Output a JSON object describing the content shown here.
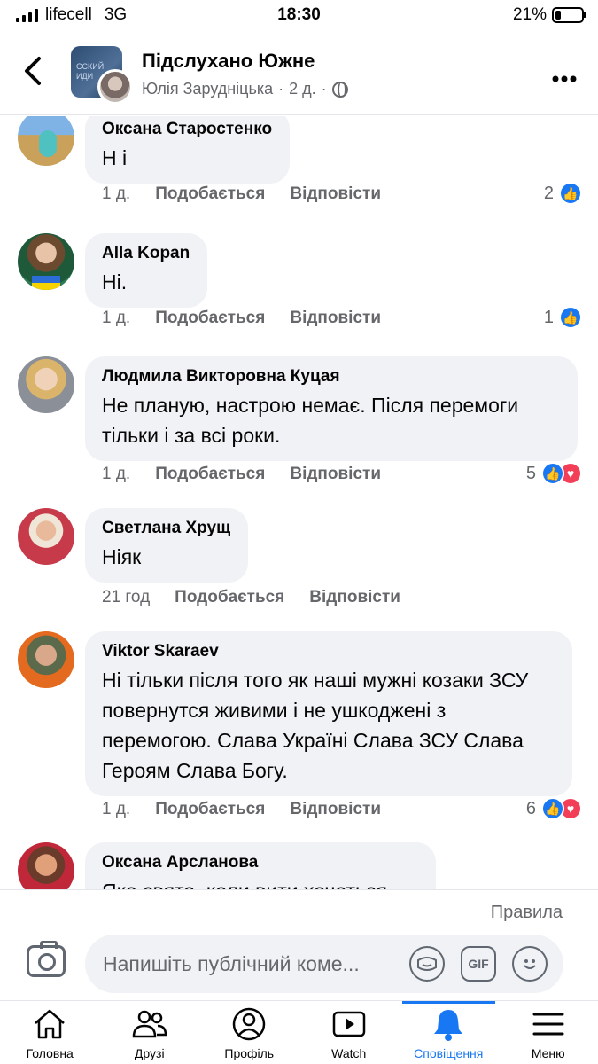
{
  "status_bar": {
    "carrier": "lifecell",
    "network": "3G",
    "time": "18:30",
    "battery": "21%",
    "battery_level": 0.21
  },
  "header": {
    "group_name": "Підслухано Южне",
    "author": "Юлія Зарудніцька",
    "time": "2 д.",
    "separator": "·",
    "group_avatar_text": "ССКИЙ ИДИ",
    "back_icon": "chevron-left-icon",
    "more_icon": "more-horizontal-icon"
  },
  "comments": [
    {
      "author": "Оксана Старостенко",
      "text": "Н і",
      "time": "1 д.",
      "like": "Подобається",
      "reply": "Відповісти",
      "reactions": "2",
      "reaction_types": [
        "like"
      ]
    },
    {
      "author": "Alla Kopan",
      "text": "Ні.",
      "time": "1 д.",
      "like": "Подобається",
      "reply": "Відповісти",
      "reactions": "1",
      "reaction_types": [
        "like"
      ]
    },
    {
      "author": "Людмила Викторовна Куцая",
      "text": "Не планую, настрою немає. Після перемоги тільки і за всі роки.",
      "time": "1 д.",
      "like": "Подобається",
      "reply": "Відповісти",
      "reactions": "5",
      "reaction_types": [
        "like",
        "love"
      ]
    },
    {
      "author": "Светлана Хрущ",
      "text": "Ніяк",
      "time": "21 год",
      "like": "Подобається",
      "reply": "Відповісти",
      "reactions": "",
      "reaction_types": []
    },
    {
      "author": "Viktor Skaraev",
      "text": "Ні тільки після того як наші мужні козаки ЗСУ повернутся живими і не ушкоджені з перемогою. Слава Україні Слава ЗСУ Слава Героям Слава Богу.",
      "time": "1 д.",
      "like": "Подобається",
      "reply": "Відповісти",
      "reactions": "6",
      "reaction_types": [
        "like",
        "love"
      ]
    },
    {
      "author": "Оксана Арсланова",
      "text": "Яке свято, коли вити хочеться",
      "time": "",
      "like": "",
      "reply": "",
      "reactions": "",
      "reaction_types": []
    }
  ],
  "composer": {
    "rules": "Правила",
    "placeholder": "Напишіть публічний коме...",
    "gif": "GIF",
    "icons": [
      "camera-icon",
      "sticker-icon",
      "gif-icon",
      "emoji-icon"
    ]
  },
  "tabs": [
    {
      "label": "Головна",
      "icon": "home-icon"
    },
    {
      "label": "Друзі",
      "icon": "friends-icon"
    },
    {
      "label": "Профіль",
      "icon": "profile-icon"
    },
    {
      "label": "Watch",
      "icon": "watch-icon"
    },
    {
      "label": "Сповіщення",
      "icon": "bell-icon",
      "active": true
    },
    {
      "label": "Меню",
      "icon": "menu-icon"
    }
  ],
  "colors": {
    "accent": "#1877f2",
    "love": "#f33e58",
    "bubble": "#f0f2f5",
    "secondary_text": "#65676b"
  }
}
